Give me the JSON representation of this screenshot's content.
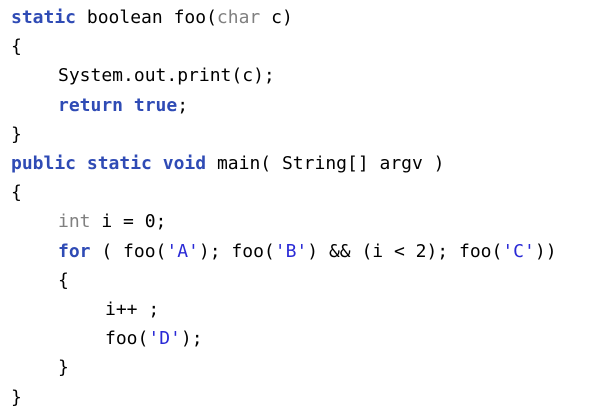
{
  "editor": {
    "colors": {
      "keyword": "#2f4bb5",
      "type_keyword": "#808080",
      "string": "#2a2ad6",
      "plain": "#000000"
    },
    "lines": [
      {
        "indent": 0,
        "tokens": [
          {
            "text": "static",
            "kind": "keyword"
          },
          {
            "text": " boolean foo(",
            "kind": "plain"
          },
          {
            "text": "char",
            "kind": "type_keyword"
          },
          {
            "text": " c)",
            "kind": "plain"
          }
        ]
      },
      {
        "indent": 0,
        "tokens": [
          {
            "text": "{",
            "kind": "plain"
          }
        ]
      },
      {
        "indent": 1,
        "tokens": [
          {
            "text": "System.out.print(c);",
            "kind": "plain"
          }
        ]
      },
      {
        "indent": 1,
        "tokens": [
          {
            "text": "return",
            "kind": "keyword"
          },
          {
            "text": " ",
            "kind": "plain"
          },
          {
            "text": "true",
            "kind": "keyword"
          },
          {
            "text": ";",
            "kind": "plain"
          }
        ]
      },
      {
        "indent": 0,
        "tokens": [
          {
            "text": "}",
            "kind": "plain"
          }
        ]
      },
      {
        "indent": 0,
        "tokens": [
          {
            "text": "public",
            "kind": "keyword"
          },
          {
            "text": " ",
            "kind": "plain"
          },
          {
            "text": "static",
            "kind": "keyword"
          },
          {
            "text": " ",
            "kind": "plain"
          },
          {
            "text": "void",
            "kind": "keyword"
          },
          {
            "text": " main( String[] argv )",
            "kind": "plain"
          }
        ]
      },
      {
        "indent": 0,
        "tokens": [
          {
            "text": "{",
            "kind": "plain"
          }
        ]
      },
      {
        "indent": 1,
        "tokens": [
          {
            "text": "int",
            "kind": "type_keyword"
          },
          {
            "text": " i = 0;",
            "kind": "plain"
          }
        ]
      },
      {
        "indent": 1,
        "tokens": [
          {
            "text": "for",
            "kind": "keyword"
          },
          {
            "text": " ( foo(",
            "kind": "plain"
          },
          {
            "text": "'A'",
            "kind": "string"
          },
          {
            "text": "); foo(",
            "kind": "plain"
          },
          {
            "text": "'B'",
            "kind": "string"
          },
          {
            "text": ") && (i < 2); foo(",
            "kind": "plain"
          },
          {
            "text": "'C'",
            "kind": "string"
          },
          {
            "text": "))",
            "kind": "plain"
          }
        ]
      },
      {
        "indent": 1,
        "tokens": [
          {
            "text": "{",
            "kind": "plain"
          }
        ]
      },
      {
        "indent": 2,
        "tokens": [
          {
            "text": "i++ ;",
            "kind": "plain"
          }
        ]
      },
      {
        "indent": 2,
        "tokens": [
          {
            "text": "foo(",
            "kind": "plain"
          },
          {
            "text": "'D'",
            "kind": "string"
          },
          {
            "text": ");",
            "kind": "plain"
          }
        ]
      },
      {
        "indent": 1,
        "tokens": [
          {
            "text": "}",
            "kind": "plain"
          }
        ]
      },
      {
        "indent": 0,
        "tokens": [
          {
            "text": "}",
            "kind": "plain"
          }
        ]
      }
    ]
  }
}
